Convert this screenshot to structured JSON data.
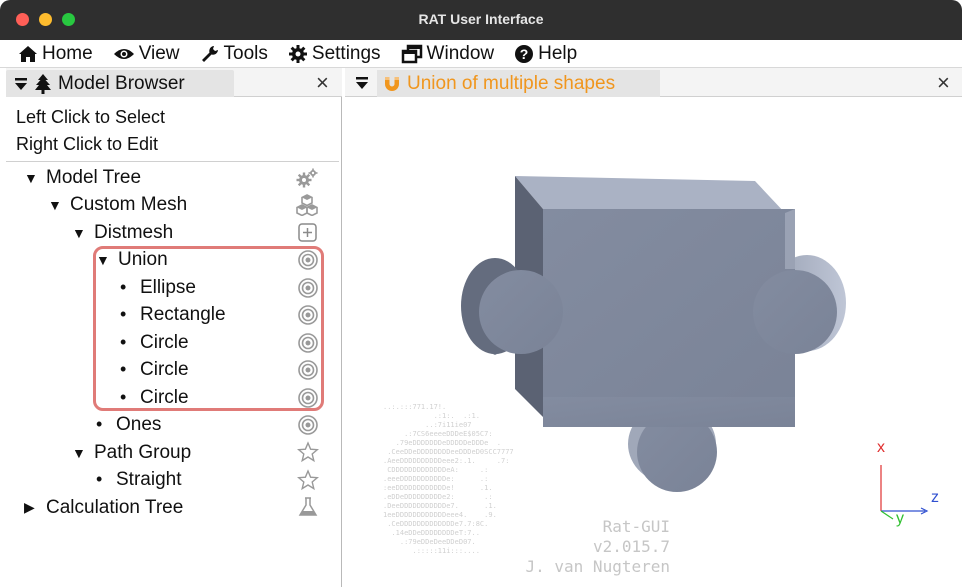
{
  "window": {
    "title": "RAT User Interface"
  },
  "menu": [
    {
      "label": "Home",
      "icon": "home-icon"
    },
    {
      "label": "View",
      "icon": "eye-icon"
    },
    {
      "label": "Tools",
      "icon": "wrench-icon"
    },
    {
      "label": "Settings",
      "icon": "gear-icon"
    },
    {
      "label": "Window",
      "icon": "window-restore-icon"
    },
    {
      "label": "Help",
      "icon": "question-circle-icon"
    }
  ],
  "left_panel": {
    "tab_label": "Model Browser",
    "hint_left": "Left Click to Select",
    "hint_right": "Right Click to Edit",
    "tree": [
      {
        "label": "Model Tree",
        "marker": "▼",
        "icon": "gears-icon"
      },
      {
        "label": "Custom Mesh",
        "marker": "▼",
        "icon": "cubes-icon"
      },
      {
        "label": "Distmesh",
        "marker": "▼",
        "icon": "plus-square-icon"
      },
      {
        "label": "Union",
        "marker": "▼",
        "icon": "target-icon"
      },
      {
        "label": "Ellipse",
        "marker": "•",
        "icon": "target-icon"
      },
      {
        "label": "Rectangle",
        "marker": "•",
        "icon": "target-icon"
      },
      {
        "label": "Circle",
        "marker": "•",
        "icon": "target-icon"
      },
      {
        "label": "Circle",
        "marker": "•",
        "icon": "target-icon"
      },
      {
        "label": "Circle",
        "marker": "•",
        "icon": "target-icon"
      },
      {
        "label": "Ones",
        "marker": "•",
        "icon": "target-icon"
      },
      {
        "label": "Path Group",
        "marker": "▼",
        "icon": "star-icon"
      },
      {
        "label": "Straight",
        "marker": "•",
        "icon": "star-icon"
      },
      {
        "label": "Calculation Tree",
        "marker": "▶",
        "icon": "flask-icon"
      }
    ]
  },
  "right_panel": {
    "tab_label": "Union of multiple shapes",
    "axes": {
      "x": "x",
      "y": "y",
      "z": "z"
    },
    "splash": {
      "name": "Rat-GUI",
      "version": "v2.015.7",
      "author": "J. van Nugteren"
    }
  },
  "colors": {
    "accent": "#f0961e",
    "highlight": "#e07b78",
    "shape": "#8a93a6"
  }
}
